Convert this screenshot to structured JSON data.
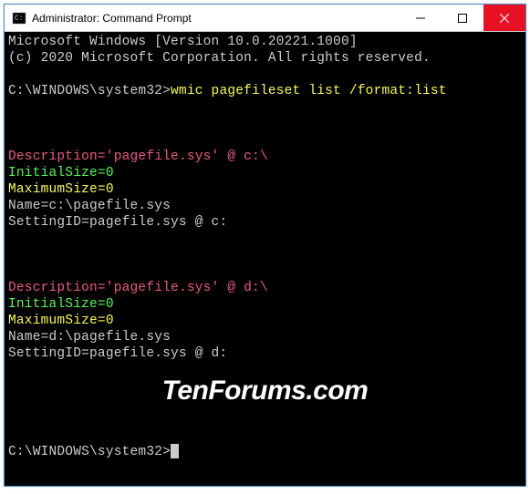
{
  "window": {
    "title": "Administrator: Command Prompt"
  },
  "terminal": {
    "header1": "Microsoft Windows [Version 10.0.20221.1000]",
    "header2": "(c) 2020 Microsoft Corporation. All rights reserved.",
    "prompt": "C:\\WINDOWS\\system32>",
    "command": "wmic pagefileset list /format:list",
    "entries": [
      {
        "description_label": "Description=",
        "description_value": "'pagefile.sys' @ c:\\",
        "initial": "InitialSize=0",
        "maximum": "MaximumSize=0",
        "name": "Name=c:\\pagefile.sys",
        "setting": "SettingID=pagefile.sys @ c:"
      },
      {
        "description_label": "Description=",
        "description_value": "'pagefile.sys' @ d:\\",
        "initial": "InitialSize=0",
        "maximum": "MaximumSize=0",
        "name": "Name=d:\\pagefile.sys",
        "setting": "SettingID=pagefile.sys @ d:"
      }
    ]
  },
  "watermark": "TenForums.com"
}
